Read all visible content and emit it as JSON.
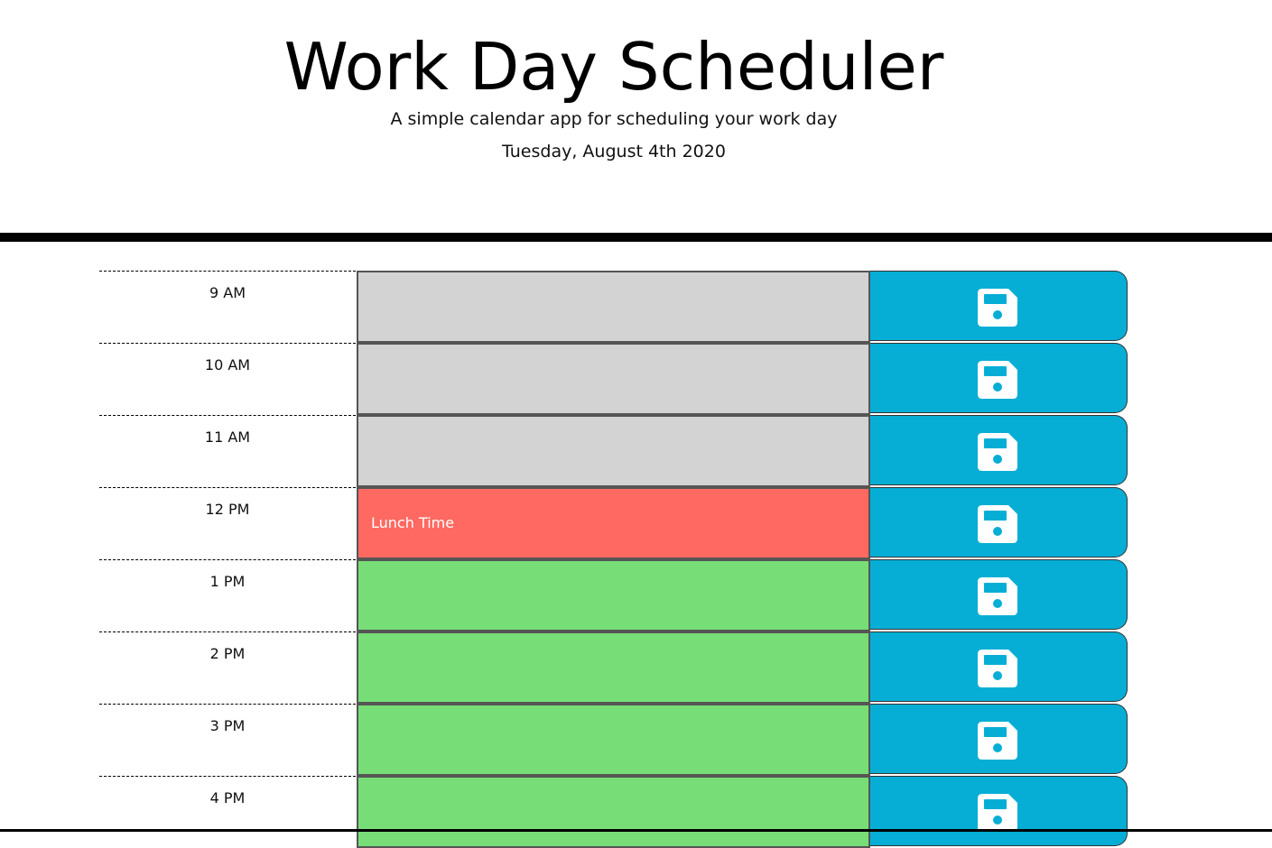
{
  "header": {
    "title": "Work Day Scheduler",
    "subtitle": "A simple calendar app for scheduling your work day",
    "current_day": "Tuesday, August 4th 2020"
  },
  "colors": {
    "past": "#d3d3d3",
    "present": "#ff6961",
    "future": "#77dd77",
    "save_button": "#06aed5"
  },
  "time_blocks": [
    {
      "hour": "9 AM",
      "state": "past",
      "text": "",
      "icon": "floppy-disk-icon"
    },
    {
      "hour": "10 AM",
      "state": "past",
      "text": "",
      "icon": "floppy-disk-icon"
    },
    {
      "hour": "11 AM",
      "state": "past",
      "text": "",
      "icon": "floppy-disk-icon"
    },
    {
      "hour": "12 PM",
      "state": "present",
      "text": "Lunch Time",
      "icon": "floppy-disk-icon"
    },
    {
      "hour": "1 PM",
      "state": "future",
      "text": "",
      "icon": "floppy-disk-icon"
    },
    {
      "hour": "2 PM",
      "state": "future",
      "text": "",
      "icon": "floppy-disk-icon"
    },
    {
      "hour": "3 PM",
      "state": "future",
      "text": "",
      "icon": "floppy-disk-icon"
    },
    {
      "hour": "4 PM",
      "state": "future",
      "text": "",
      "icon": "floppy-disk-icon"
    }
  ]
}
